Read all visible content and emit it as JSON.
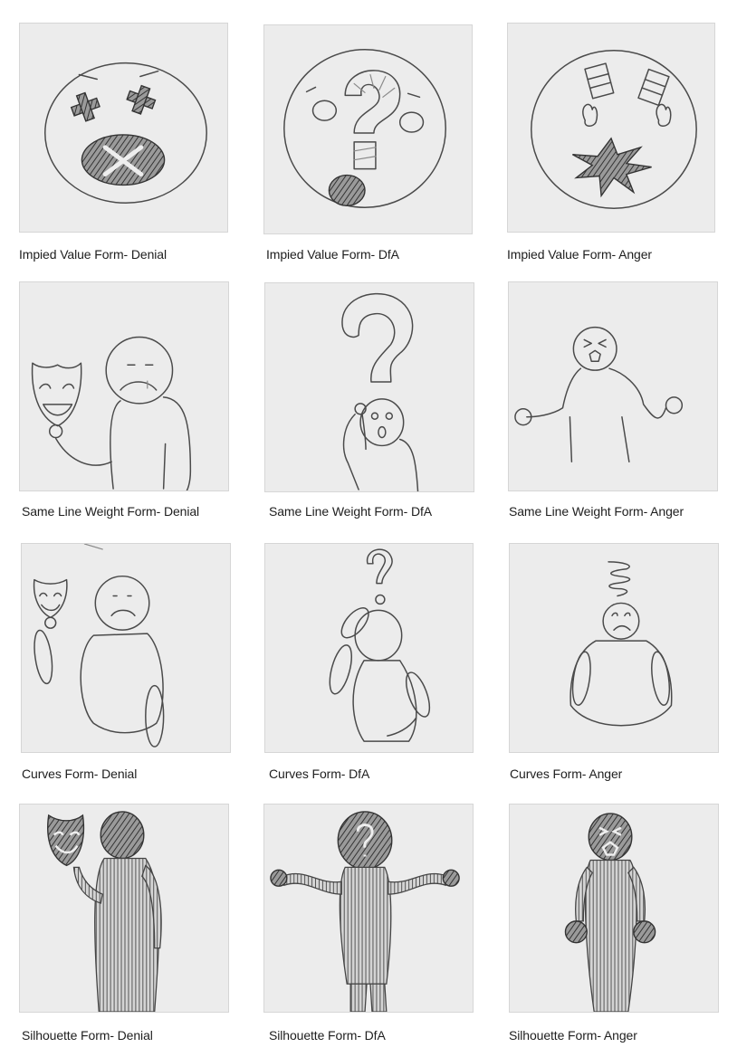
{
  "captions": {
    "r1c1": "Impied Value Form- Denial",
    "r1c2": "Impied Value Form- DfA",
    "r1c3": "Impied Value Form- Anger",
    "r2c1": "Same Line Weight Form- Denial",
    "r2c2": "Same Line Weight Form- DfA",
    "r2c3": "Same Line Weight Form- Anger",
    "r3c1": "Curves Form- Denial",
    "r3c2": "Curves Form- DfA",
    "r3c3": "Curves Form- Anger",
    "r4c1": "Silhouette Form- Denial",
    "r4c2": "Silhouette Form- DfA",
    "r4c3": "Silhouette Form- Anger"
  }
}
